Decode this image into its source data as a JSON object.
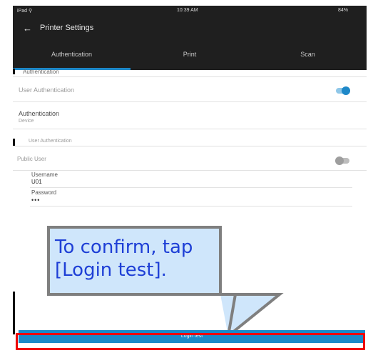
{
  "status_bar": {
    "carrier": "iPad ⚲",
    "time": "10:39 AM",
    "battery": "84%"
  },
  "app_bar": {
    "back_icon": "arrow-left-icon",
    "title": "Printer Settings"
  },
  "tabs": [
    {
      "label": "Authentication",
      "active": true
    },
    {
      "label": "Print",
      "active": false
    },
    {
      "label": "Scan",
      "active": false
    }
  ],
  "auth_section": {
    "header": "Authentication",
    "user_auth_label": "User Authentication",
    "user_auth_on": true,
    "auth_label": "Authentication",
    "auth_value": "Device"
  },
  "user_section": {
    "header": "User Authentication",
    "public_user_label": "Public User",
    "public_user_on": false,
    "username_label": "Username",
    "username_value": "U01",
    "password_label": "Password",
    "password_value": "•••"
  },
  "login_button": {
    "label": "Login test"
  },
  "callout": {
    "text": "To confirm, tap [Login test]."
  },
  "colors": {
    "accent": "#1e88c8",
    "callout_fill": "#cfe6fb",
    "callout_text": "#1e3fd6",
    "highlight": "#ee0000"
  }
}
